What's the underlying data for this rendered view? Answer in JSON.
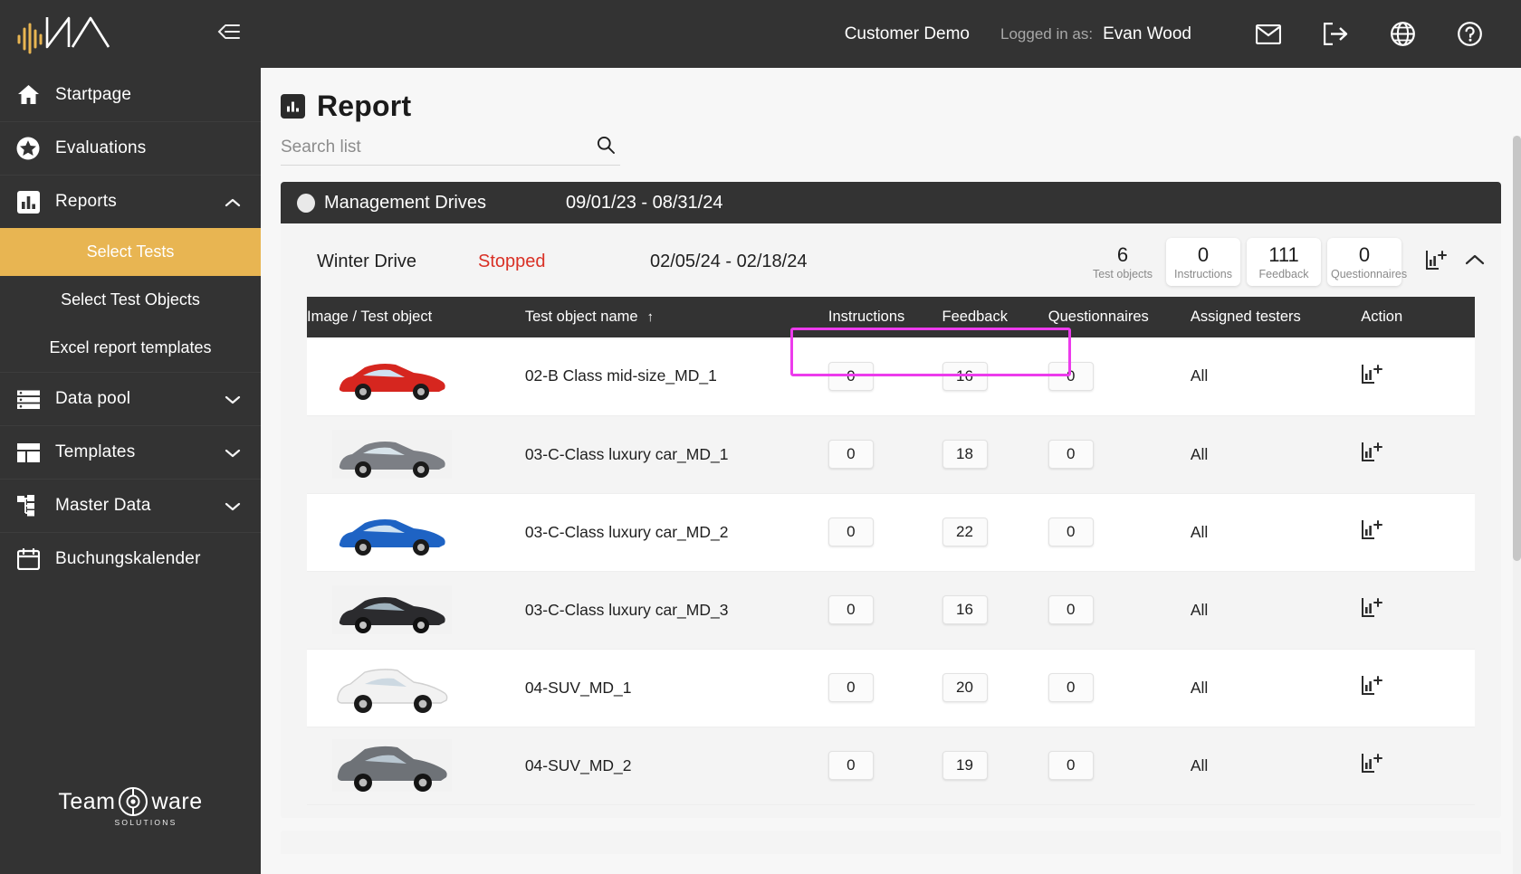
{
  "sidebar": {
    "logo_name": "waveform-logo",
    "collapse_icon": "collapse-sidebar-icon",
    "items": [
      {
        "label": "Startpage",
        "icon": "home-icon",
        "expandable": false
      },
      {
        "label": "Evaluations",
        "icon": "star-icon",
        "expandable": false
      },
      {
        "label": "Reports",
        "icon": "bar-chart-icon",
        "expandable": true,
        "chevron": "chevron-up-icon"
      },
      {
        "label": "Data pool",
        "icon": "list-icon",
        "expandable": true,
        "chevron": "chevron-down-icon"
      },
      {
        "label": "Templates",
        "icon": "layout-icon",
        "expandable": true,
        "chevron": "chevron-down-icon"
      },
      {
        "label": "Master Data",
        "icon": "hierarchy-icon",
        "expandable": true,
        "chevron": "chevron-down-icon"
      },
      {
        "label": "Buchungskalender",
        "icon": "calendar-icon",
        "expandable": false
      }
    ],
    "sub_items": [
      {
        "label": "Select Tests",
        "active": true
      },
      {
        "label": "Select Test Objects",
        "active": false
      },
      {
        "label": "Excel report templates",
        "active": false
      }
    ],
    "footer": {
      "brand_a": "Team",
      "brand_b": "ware",
      "brand_sub": "SOLUTIONS"
    },
    "active_color": "#e8b552"
  },
  "topbar": {
    "customer": "Customer Demo",
    "logged_label": "Logged in as:",
    "user_name": "Evan Wood",
    "icons": [
      "mail-icon",
      "logout-icon",
      "language-globe-icon",
      "help-icon"
    ]
  },
  "page": {
    "title": "Report",
    "title_icon": "bar-chart-icon"
  },
  "search": {
    "placeholder": "Search list",
    "value": "",
    "icon": "search-icon"
  },
  "group": {
    "name": "Management Drives",
    "dates": "09/01/23 - 08/31/24",
    "status_dot": "status-dot-grey"
  },
  "drive": {
    "name": "Winter Drive",
    "status": "Stopped",
    "status_color": "#d93025",
    "dates": "02/05/24 - 02/18/24",
    "stats": [
      {
        "value": "6",
        "label": "Test objects",
        "boxed": false
      },
      {
        "value": "0",
        "label": "Instructions",
        "boxed": true
      },
      {
        "value": "111",
        "label": "Feedback",
        "boxed": true
      },
      {
        "value": "0",
        "label": "Questionnaires",
        "boxed": true
      }
    ],
    "actions": [
      {
        "icon": "add-report-chart-icon"
      },
      {
        "icon": "chevron-up-icon"
      }
    ]
  },
  "table": {
    "columns": [
      "Image / Test object",
      "Test object name",
      "Instructions",
      "Feedback",
      "Questionnaires",
      "Assigned testers",
      "Action"
    ],
    "sorted_column": "Test object name",
    "sort_direction": "asc",
    "sort_glyph": "↑",
    "rows": [
      {
        "name": "02-B Class mid-size_MD_1",
        "instructions": "0",
        "feedback": "16",
        "questionnaires": "0",
        "testers": "All",
        "action_icon": "add-report-chart-icon",
        "car_color": "#d6261f",
        "car_type": "sedan",
        "highlighted": true
      },
      {
        "name": "03-C-Class luxury car_MD_1",
        "instructions": "0",
        "feedback": "18",
        "questionnaires": "0",
        "testers": "All",
        "action_icon": "add-report-chart-icon",
        "car_color": "#7c7f85",
        "car_type": "sedan",
        "highlighted": false
      },
      {
        "name": "03-C-Class luxury car_MD_2",
        "instructions": "0",
        "feedback": "22",
        "questionnaires": "0",
        "testers": "All",
        "action_icon": "add-report-chart-icon",
        "car_color": "#1e63c4",
        "car_type": "sedan",
        "highlighted": false
      },
      {
        "name": "03-C-Class luxury car_MD_3",
        "instructions": "0",
        "feedback": "16",
        "questionnaires": "0",
        "testers": "All",
        "action_icon": "add-report-chart-icon",
        "car_color": "#2b2b2e",
        "car_type": "sedan",
        "highlighted": false
      },
      {
        "name": "04-SUV_MD_1",
        "instructions": "0",
        "feedback": "20",
        "questionnaires": "0",
        "testers": "All",
        "action_icon": "add-report-chart-icon",
        "car_color": "#f2f2f2",
        "car_type": "suv",
        "highlighted": false
      },
      {
        "name": "04-SUV_MD_2",
        "instructions": "0",
        "feedback": "19",
        "questionnaires": "0",
        "testers": "All",
        "action_icon": "add-report-chart-icon",
        "car_color": "#6e7277",
        "car_type": "suv",
        "highlighted": false
      }
    ]
  },
  "highlight": {
    "color": "#ec3bec"
  }
}
